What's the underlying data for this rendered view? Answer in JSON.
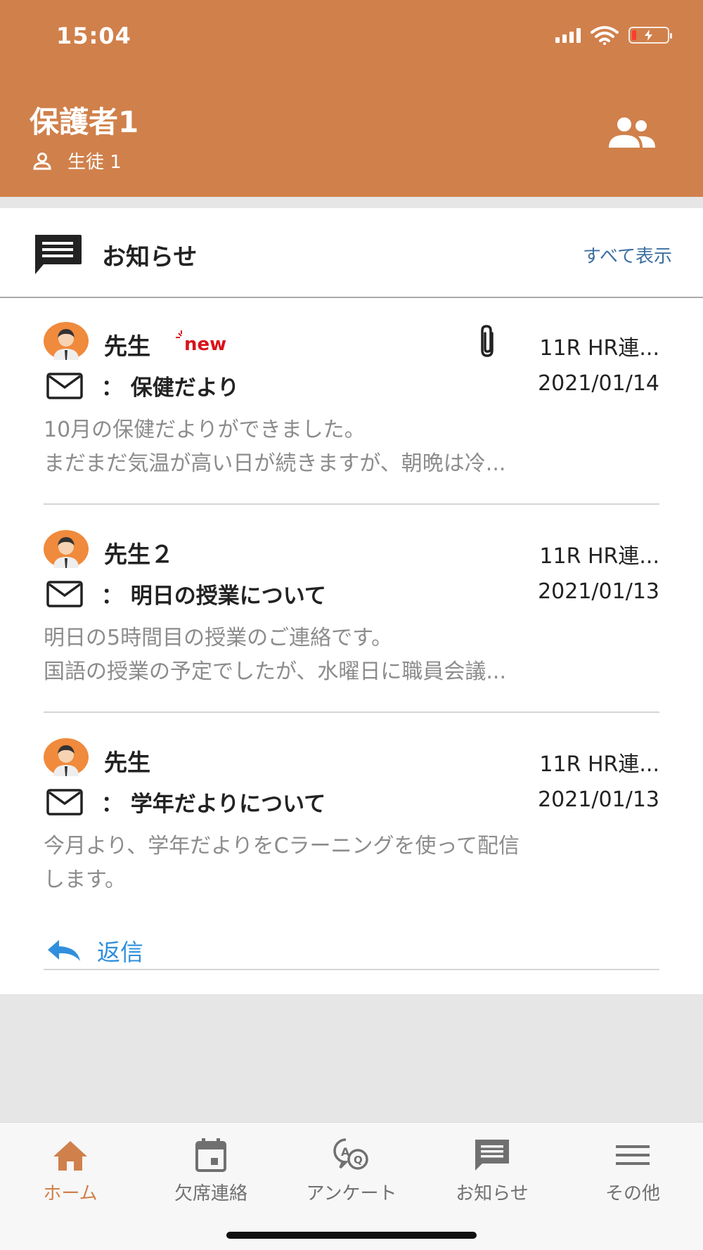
{
  "status_bar": {
    "time": "15:04"
  },
  "header": {
    "user_name": "保護者1",
    "student": "生徒 1"
  },
  "notices": {
    "title": "お知らせ",
    "view_all": "すべて表示",
    "items": [
      {
        "sender": "先生",
        "is_new": true,
        "has_attachment": true,
        "group": "11R HR連...",
        "subject": "：  保健だより",
        "date": "2021/01/14",
        "preview_line1": "10月の保健だよりができました。",
        "preview_line2": "まだまだ気温が高い日が続きますが、朝晩は冷..."
      },
      {
        "sender": "先生２",
        "is_new": false,
        "has_attachment": false,
        "group": "11R HR連...",
        "subject": "：  明日の授業について",
        "date": "2021/01/13",
        "preview_line1": "明日の5時間目の授業のご連絡です。",
        "preview_line2": "国語の授業の予定でしたが、水曜日に職員会議..."
      },
      {
        "sender": "先生",
        "is_new": false,
        "has_attachment": false,
        "group": "11R HR連...",
        "subject": "：  学年だよりについて",
        "date": "2021/01/13",
        "preview_line1": "今月より、学年だよりをCラーニングを使って配信",
        "preview_line2": "します。",
        "reply_label": "返信"
      }
    ]
  },
  "tabs": [
    {
      "label": "ホーム",
      "icon": "home-icon",
      "active": true
    },
    {
      "label": "欠席連絡",
      "icon": "calendar-icon",
      "active": false
    },
    {
      "label": "アンケート",
      "icon": "survey-icon",
      "active": false
    },
    {
      "label": "お知らせ",
      "icon": "chat-icon",
      "active": false
    },
    {
      "label": "その他",
      "icon": "menu-icon",
      "active": false
    }
  ],
  "colors": {
    "brand": "#d0804b",
    "link": "#3d6fa0",
    "reply": "#2f8fdc",
    "new_badge": "#d9141b"
  }
}
